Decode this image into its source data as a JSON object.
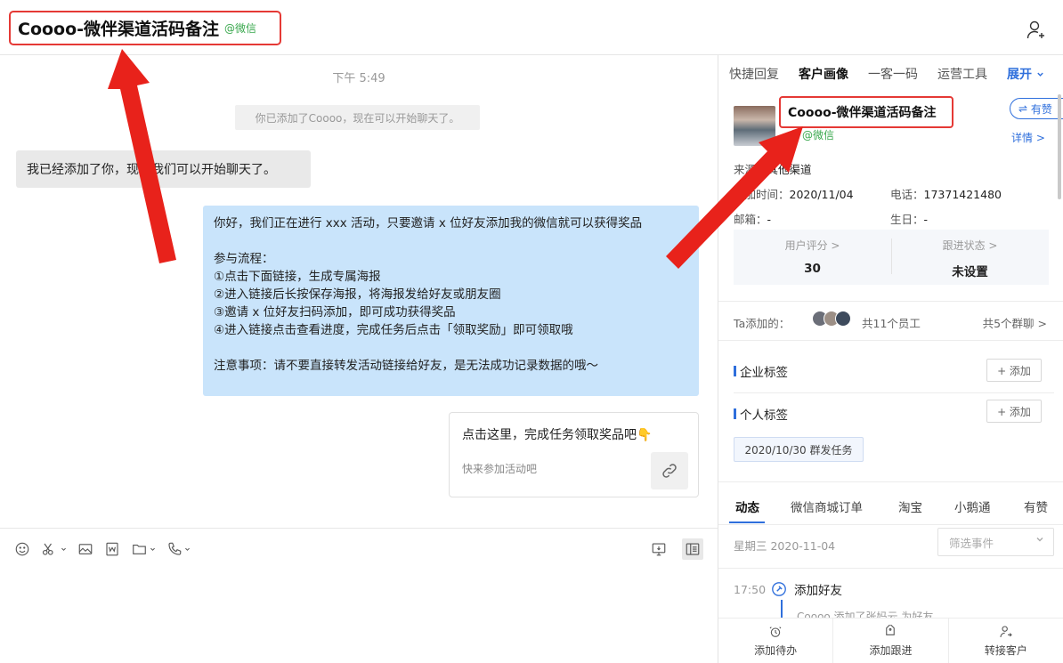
{
  "header": {
    "chat_title": "Coooo-微伴渠道活码备注",
    "platform_tag": "@微信",
    "add_member_icon": "add-member-icon"
  },
  "chat": {
    "timestamp": "下午 5:49",
    "system_message": "你已添加了Coooo，现在可以开始聊天了。",
    "incoming_message": "我已经添加了你，现在我们可以开始聊天了。",
    "outgoing_message": {
      "intro": "你好，我们正在进行 xxx 活动，只要邀请 x 位好友添加我的微信就可以获得奖品",
      "flow_title": "参与流程：",
      "step1": "①点击下面链接，生成专属海报",
      "step2": "②进入链接后长按保存海报，将海报发给好友或朋友圈",
      "step3": "③邀请 x 位好友扫码添加，即可成功获得奖品",
      "step4": "④进入链接点击查看进度，完成任务后点击「领取奖励」即可领取哦",
      "note": "注意事项：请不要直接转发活动链接给好友，是无法成功记录数据的哦～"
    },
    "link_card": {
      "title": "点击这里，完成任务领取奖品吧",
      "title_emoji": "👇",
      "description": "快来参加活动吧"
    },
    "toolbar_icons": [
      "emoji-icon",
      "scissors-icon",
      "image-icon",
      "word-icon",
      "folder-icon",
      "phone-icon",
      "screen-share-icon",
      "sidebar-toggle-icon"
    ]
  },
  "panel": {
    "tabs": [
      "快捷回复",
      "客户画像",
      "一客一码",
      "运营工具"
    ],
    "active_tab": "客户画像",
    "expand_label": "展开",
    "customer": {
      "name": "Coooo-微伴渠道活码备注",
      "platform": "@微信",
      "youzan_label": "有赞",
      "detail_label": "详情 >"
    },
    "info": {
      "source_label": "来源：",
      "source_value": "其他渠道",
      "added_time_label": "添加时间：",
      "added_time_value": "2020/11/04",
      "phone_label": "电话：",
      "phone_value": "17371421480",
      "email_label": "邮箱：",
      "email_value": "-",
      "birthday_label": "生日：",
      "birthday_value": "-"
    },
    "stats": {
      "score_label": "用户评分 >",
      "score_value": "30",
      "status_label": "跟进状态 >",
      "status_value": "未设置"
    },
    "added_by": {
      "label": "Ta添加的：",
      "employee_count": "共11个员工",
      "group_count": "共5个群聊 >"
    },
    "tags": {
      "enterprise_label": "企业标签",
      "personal_label": "个人标签",
      "add_label": "+ 添加",
      "chip": "2020/10/30 群发任务"
    },
    "activity": {
      "tabs": [
        "动态",
        "微信商城订单",
        "淘宝",
        "小鹅通",
        "有赞"
      ],
      "active_tab": "动态",
      "date": "星期三   2020-11-04",
      "filter_placeholder": "筛选事件",
      "event_time": "17:50",
      "event_title": "添加好友",
      "event_desc": "Coooo 添加了张妈云 为好友"
    },
    "bottom_actions": [
      "添加待办",
      "添加跟进",
      "转接客户"
    ]
  },
  "colors": {
    "accent": "#2f6fdc",
    "highlight_red": "#e53935",
    "wechat_green": "#3aa84e",
    "outgoing_bubble": "#c9e4fb"
  }
}
